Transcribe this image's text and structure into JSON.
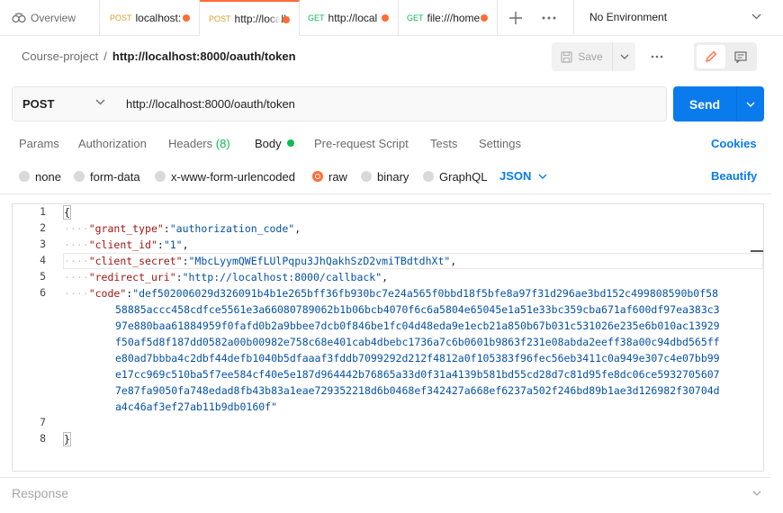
{
  "tabs": [
    {
      "method": "",
      "label": "Overview",
      "icon": "overview-icon",
      "unsaved": false
    },
    {
      "method": "POST",
      "label": "localhost:",
      "unsaved": true
    },
    {
      "method": "POST",
      "label": "http://localh",
      "unsaved": true,
      "active": true
    },
    {
      "method": "GET",
      "label": "http://local",
      "unsaved": true
    },
    {
      "method": "GET",
      "label": "file:///home",
      "unsaved": true
    }
  ],
  "environment": "No Environment",
  "breadcrumb": {
    "parent": "Course-project",
    "separator": "/",
    "current": "http://localhost:8000/oauth/token"
  },
  "toolbar": {
    "save_label": "Save"
  },
  "request": {
    "method": "POST",
    "url": "http://localhost:8000/oauth/token",
    "send_label": "Send"
  },
  "request_tabs": {
    "params": "Params",
    "authorization": "Authorization",
    "headers": "Headers",
    "headers_count": "(8)",
    "body": "Body",
    "prerequest": "Pre-request Script",
    "tests": "Tests",
    "settings": "Settings",
    "cookies": "Cookies"
  },
  "body_types": {
    "none": "none",
    "form_data": "form-data",
    "urlencoded": "x-www-form-urlencoded",
    "raw": "raw",
    "binary": "binary",
    "graphql": "GraphQL",
    "language": "JSON",
    "beautify": "Beautify",
    "selected": "raw"
  },
  "editor": {
    "line_numbers": [
      "1",
      "2",
      "3",
      "4",
      "5",
      "6",
      "7",
      "8"
    ],
    "open_brace": "{",
    "close_brace": "}",
    "lines": [
      {
        "key": "\"grant_type\"",
        "value": "\"authorization_code\""
      },
      {
        "key": "\"client_id\"",
        "value": "\"1\""
      },
      {
        "key": "\"client_secret\"",
        "value": "\"MbcLyymQWEfLUlPqpu3JhQakhSzD2vmiTBdtdhXt\""
      },
      {
        "key": "\"redirect_uri\"",
        "value": "\"http://localhost:8000/callback\""
      },
      {
        "key": "\"code\"",
        "value": "\"def502006029d326091b4b1e265bff36fb930bc7e24a565f0bbd18f5bfe8a97f31d296ae3bd152c499808590b0f58"
      }
    ],
    "code_continuation": [
      "58885accc458cdfce5561e3a66080789062b1b06bcb4070f6c6a5804e65045e1a51e33bc359cba671af600df97ea383c3",
      "97e880baa61884959f0fafd0b2a9bbee7dcb0f846be1fc04d48eda9e1ecb21a850b67b031c531026e235e6b010ac13929",
      "f50af5d8f187dd0582a00b00982e758c68e401cab4dbebc1736a7c6b0601b9863f231e08abda2eeff38a00c94dbd565ff",
      "e80ad7bbba4c2dbf44defb1040b5dfaaaf3fddb7099292d212f4812a0f105383f96fec56eb3411c0a949e307c4e07bb99",
      "e17cc969c510ba5f7ee584cf40e5e187d964442b76865a33d0f31a4139b581bd55cd28d7c81d95fe8dc06ce5932705607",
      "7e87fa9050fa748edad8fb43b83a1eae729352218d6b0468ef342427a668ef6237a502f246bd89b1ae3d126982f30704d",
      "a4c46af3ef27ab11b9db0160f\""
    ]
  },
  "response": {
    "label": "Response"
  },
  "colors": {
    "accent": "#ff6c37",
    "send": "#097bed",
    "post": "#dc9f2a",
    "get": "#0cbb52"
  }
}
